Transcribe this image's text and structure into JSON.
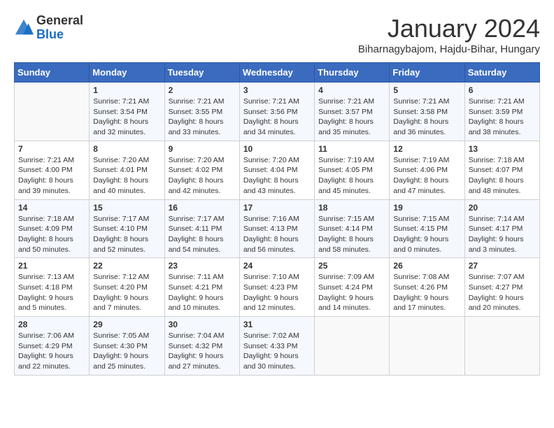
{
  "header": {
    "logo_general": "General",
    "logo_blue": "Blue",
    "month": "January 2024",
    "location": "Biharnagybajom, Hajdu-Bihar, Hungary"
  },
  "weekdays": [
    "Sunday",
    "Monday",
    "Tuesday",
    "Wednesday",
    "Thursday",
    "Friday",
    "Saturday"
  ],
  "weeks": [
    [
      {
        "day": "",
        "info": ""
      },
      {
        "day": "1",
        "info": "Sunrise: 7:21 AM\nSunset: 3:54 PM\nDaylight: 8 hours\nand 32 minutes."
      },
      {
        "day": "2",
        "info": "Sunrise: 7:21 AM\nSunset: 3:55 PM\nDaylight: 8 hours\nand 33 minutes."
      },
      {
        "day": "3",
        "info": "Sunrise: 7:21 AM\nSunset: 3:56 PM\nDaylight: 8 hours\nand 34 minutes."
      },
      {
        "day": "4",
        "info": "Sunrise: 7:21 AM\nSunset: 3:57 PM\nDaylight: 8 hours\nand 35 minutes."
      },
      {
        "day": "5",
        "info": "Sunrise: 7:21 AM\nSunset: 3:58 PM\nDaylight: 8 hours\nand 36 minutes."
      },
      {
        "day": "6",
        "info": "Sunrise: 7:21 AM\nSunset: 3:59 PM\nDaylight: 8 hours\nand 38 minutes."
      }
    ],
    [
      {
        "day": "7",
        "info": "Sunrise: 7:21 AM\nSunset: 4:00 PM\nDaylight: 8 hours\nand 39 minutes."
      },
      {
        "day": "8",
        "info": "Sunrise: 7:20 AM\nSunset: 4:01 PM\nDaylight: 8 hours\nand 40 minutes."
      },
      {
        "day": "9",
        "info": "Sunrise: 7:20 AM\nSunset: 4:02 PM\nDaylight: 8 hours\nand 42 minutes."
      },
      {
        "day": "10",
        "info": "Sunrise: 7:20 AM\nSunset: 4:04 PM\nDaylight: 8 hours\nand 43 minutes."
      },
      {
        "day": "11",
        "info": "Sunrise: 7:19 AM\nSunset: 4:05 PM\nDaylight: 8 hours\nand 45 minutes."
      },
      {
        "day": "12",
        "info": "Sunrise: 7:19 AM\nSunset: 4:06 PM\nDaylight: 8 hours\nand 47 minutes."
      },
      {
        "day": "13",
        "info": "Sunrise: 7:18 AM\nSunset: 4:07 PM\nDaylight: 8 hours\nand 48 minutes."
      }
    ],
    [
      {
        "day": "14",
        "info": "Sunrise: 7:18 AM\nSunset: 4:09 PM\nDaylight: 8 hours\nand 50 minutes."
      },
      {
        "day": "15",
        "info": "Sunrise: 7:17 AM\nSunset: 4:10 PM\nDaylight: 8 hours\nand 52 minutes."
      },
      {
        "day": "16",
        "info": "Sunrise: 7:17 AM\nSunset: 4:11 PM\nDaylight: 8 hours\nand 54 minutes."
      },
      {
        "day": "17",
        "info": "Sunrise: 7:16 AM\nSunset: 4:13 PM\nDaylight: 8 hours\nand 56 minutes."
      },
      {
        "day": "18",
        "info": "Sunrise: 7:15 AM\nSunset: 4:14 PM\nDaylight: 8 hours\nand 58 minutes."
      },
      {
        "day": "19",
        "info": "Sunrise: 7:15 AM\nSunset: 4:15 PM\nDaylight: 9 hours\nand 0 minutes."
      },
      {
        "day": "20",
        "info": "Sunrise: 7:14 AM\nSunset: 4:17 PM\nDaylight: 9 hours\nand 3 minutes."
      }
    ],
    [
      {
        "day": "21",
        "info": "Sunrise: 7:13 AM\nSunset: 4:18 PM\nDaylight: 9 hours\nand 5 minutes."
      },
      {
        "day": "22",
        "info": "Sunrise: 7:12 AM\nSunset: 4:20 PM\nDaylight: 9 hours\nand 7 minutes."
      },
      {
        "day": "23",
        "info": "Sunrise: 7:11 AM\nSunset: 4:21 PM\nDaylight: 9 hours\nand 10 minutes."
      },
      {
        "day": "24",
        "info": "Sunrise: 7:10 AM\nSunset: 4:23 PM\nDaylight: 9 hours\nand 12 minutes."
      },
      {
        "day": "25",
        "info": "Sunrise: 7:09 AM\nSunset: 4:24 PM\nDaylight: 9 hours\nand 14 minutes."
      },
      {
        "day": "26",
        "info": "Sunrise: 7:08 AM\nSunset: 4:26 PM\nDaylight: 9 hours\nand 17 minutes."
      },
      {
        "day": "27",
        "info": "Sunrise: 7:07 AM\nSunset: 4:27 PM\nDaylight: 9 hours\nand 20 minutes."
      }
    ],
    [
      {
        "day": "28",
        "info": "Sunrise: 7:06 AM\nSunset: 4:29 PM\nDaylight: 9 hours\nand 22 minutes."
      },
      {
        "day": "29",
        "info": "Sunrise: 7:05 AM\nSunset: 4:30 PM\nDaylight: 9 hours\nand 25 minutes."
      },
      {
        "day": "30",
        "info": "Sunrise: 7:04 AM\nSunset: 4:32 PM\nDaylight: 9 hours\nand 27 minutes."
      },
      {
        "day": "31",
        "info": "Sunrise: 7:02 AM\nSunset: 4:33 PM\nDaylight: 9 hours\nand 30 minutes."
      },
      {
        "day": "",
        "info": ""
      },
      {
        "day": "",
        "info": ""
      },
      {
        "day": "",
        "info": ""
      }
    ]
  ]
}
